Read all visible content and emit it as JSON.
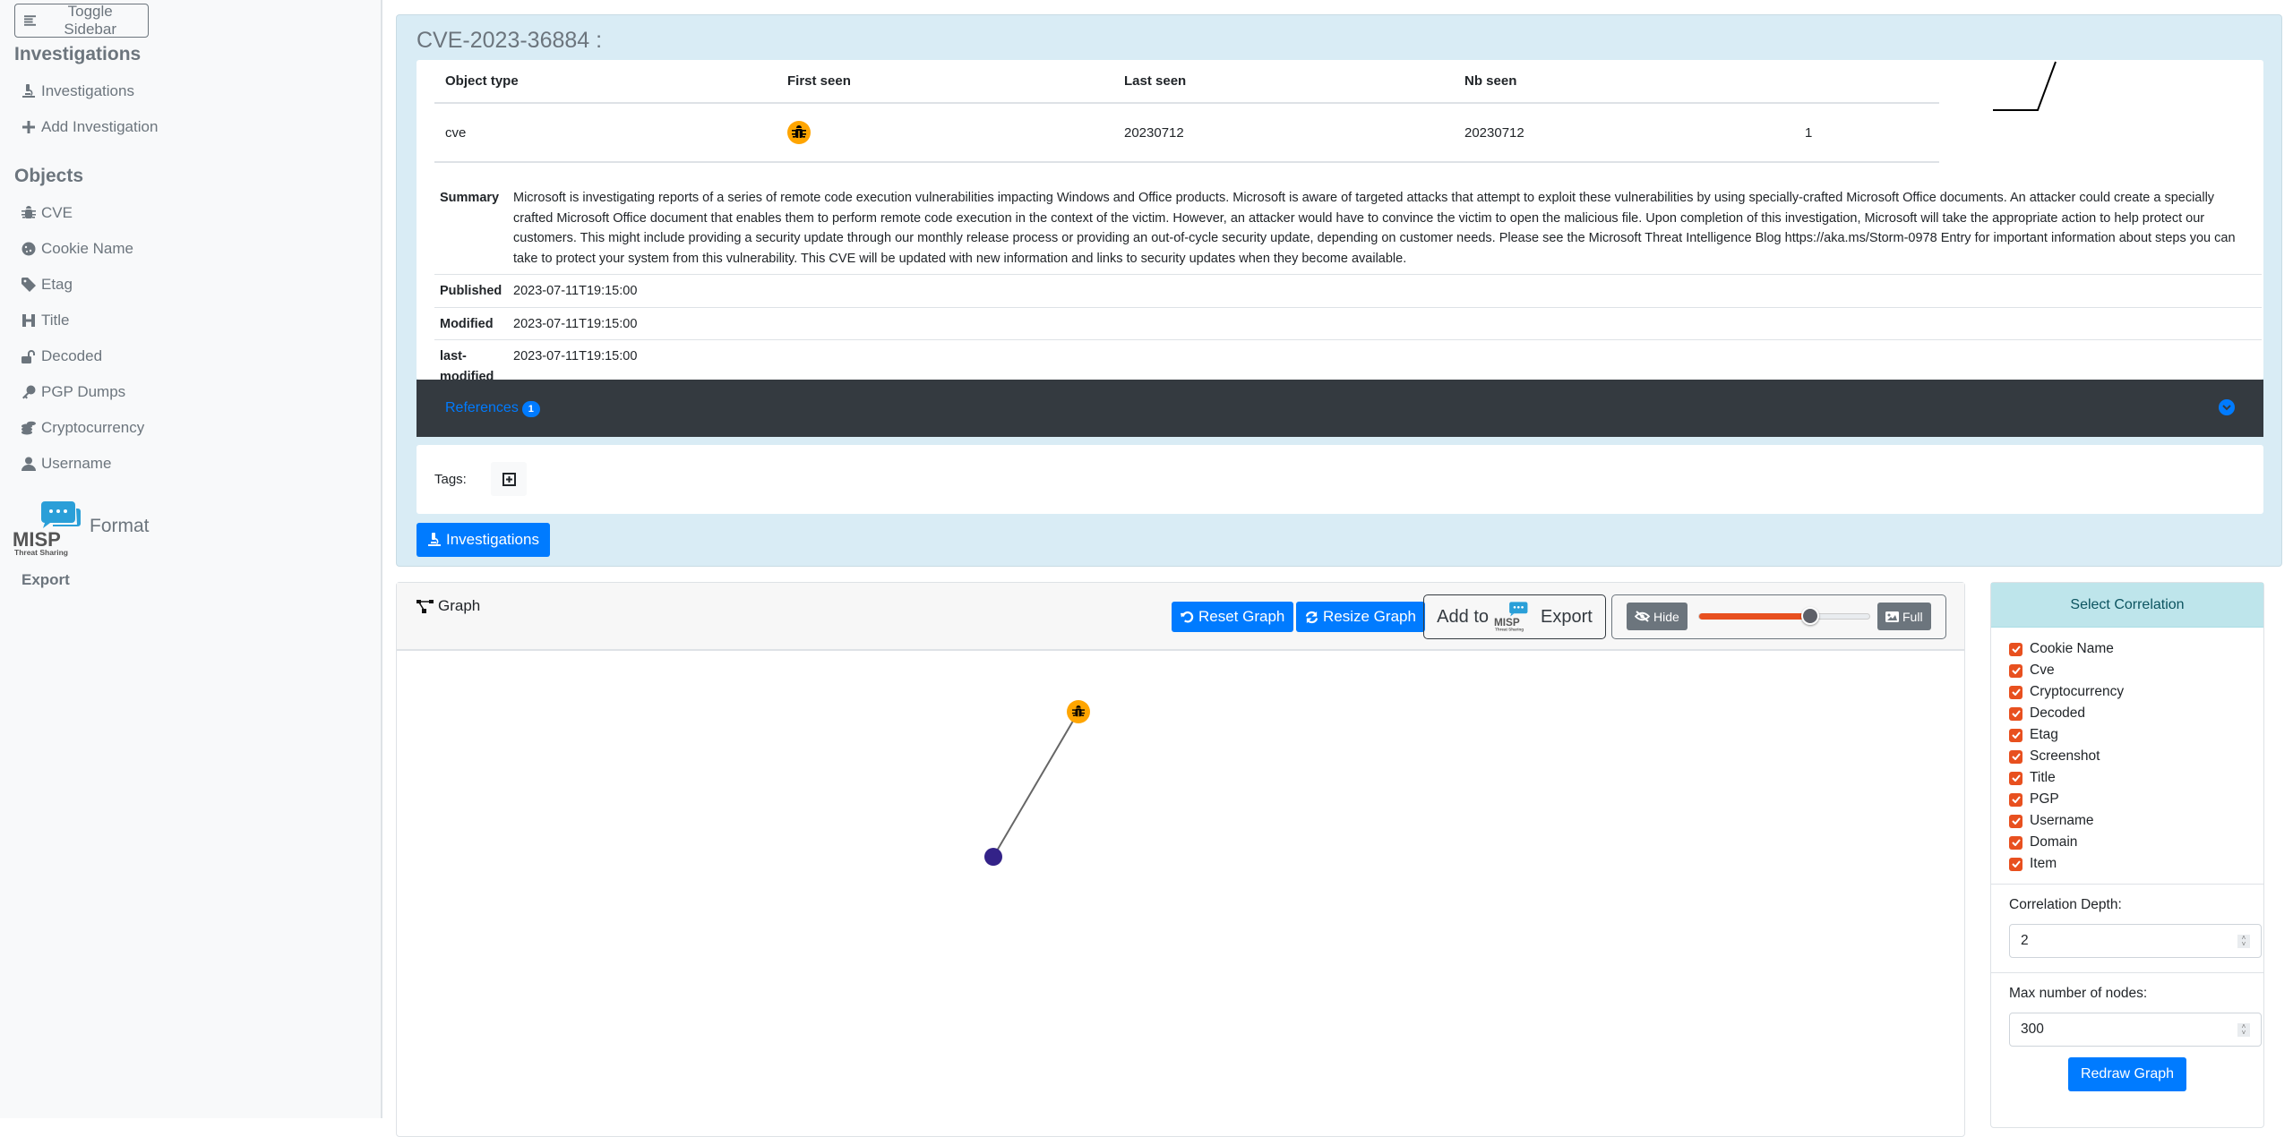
{
  "sidebar": {
    "toggle_label": "Toggle Sidebar",
    "investigations_heading": "Investigations",
    "investigation_items": [
      {
        "label": "Investigations",
        "icon": "microscope-icon"
      },
      {
        "label": "Add Investigation",
        "icon": "plus-icon"
      }
    ],
    "objects_heading": "Objects",
    "object_items": [
      {
        "label": "CVE",
        "icon": "bug-icon"
      },
      {
        "label": "Cookie Name",
        "icon": "cookie-icon"
      },
      {
        "label": "Etag",
        "icon": "tag-icon"
      },
      {
        "label": "Title",
        "icon": "heading-icon"
      },
      {
        "label": "Decoded",
        "icon": "unlock-icon"
      },
      {
        "label": "PGP Dumps",
        "icon": "key-icon"
      },
      {
        "label": "Cryptocurrency",
        "icon": "coins-icon"
      },
      {
        "label": "Username",
        "icon": "user-icon"
      }
    ],
    "logo_text": "MISP",
    "logo_subtext": "Threat Sharing",
    "format_label": "Format",
    "export_label": "Export"
  },
  "cve": {
    "title": "CVE-2023-36884 :",
    "table_headers": [
      "Object type",
      "First seen",
      "Last seen",
      "Nb seen"
    ],
    "row": {
      "object_type": "cve",
      "icon": "bug-icon",
      "first_seen": "20230712",
      "last_seen": "20230712",
      "nb_seen": "1"
    },
    "sparkline": {
      "type": "line",
      "values": [
        0,
        0,
        0,
        1
      ]
    },
    "details": [
      {
        "key": "Summary",
        "value": "Microsoft is investigating reports of a series of remote code execution vulnerabilities impacting Windows and Office products. Microsoft is aware of targeted attacks that attempt to exploit these vulnerabilities by using specially-crafted Microsoft Office documents. An attacker could create a specially crafted Microsoft Office document that enables them to perform remote code execution in the context of the victim. However, an attacker would have to convince the victim to open the malicious file. Upon completion of this investigation, Microsoft will take the appropriate action to help protect our customers. This might include providing a security update through our monthly release process or providing an out-of-cycle security update, depending on customer needs. Please see the Microsoft Threat Intelligence Blog https://aka.ms/Storm-0978  Entry for important information about steps you can take to protect your system from this vulnerability. This CVE will be updated with new information and links to security updates when they become available."
      },
      {
        "key": "Published",
        "value": "2023-07-11T19:15:00"
      },
      {
        "key": "Modified",
        "value": "2023-07-11T19:15:00"
      },
      {
        "key": "last-modified",
        "value": "2023-07-11T19:15:00"
      }
    ],
    "references_label": "References",
    "references_count": "1",
    "tags_label": "Tags:",
    "investigations_button": "Investigations"
  },
  "graph": {
    "title": "Graph",
    "reset_label": "Reset Graph",
    "resize_label": "Resize Graph",
    "add_to_label": "Add to",
    "misp_label": "MISP",
    "misp_sub": "Threat Sharing",
    "export_label": "Export",
    "hide_label": "Hide",
    "full_label": "Full",
    "slider_value": 0.65,
    "slider_fill_color": "#e8501f",
    "nodes": [
      {
        "id": "cve",
        "type": "cve",
        "color": "#ffa500",
        "icon": "bug-icon"
      },
      {
        "id": "related",
        "type": "item",
        "color": "#332288"
      }
    ],
    "edges": [
      {
        "source": "cve",
        "target": "related"
      }
    ]
  },
  "correlation": {
    "title": "Select Correlation",
    "options": [
      {
        "label": "Cookie Name",
        "checked": true
      },
      {
        "label": "Cve",
        "checked": true
      },
      {
        "label": "Cryptocurrency",
        "checked": true
      },
      {
        "label": "Decoded",
        "checked": true
      },
      {
        "label": "Etag",
        "checked": true
      },
      {
        "label": "Screenshot",
        "checked": true
      },
      {
        "label": "Title",
        "checked": true
      },
      {
        "label": "PGP",
        "checked": true
      },
      {
        "label": "Username",
        "checked": true
      },
      {
        "label": "Domain",
        "checked": true
      },
      {
        "label": "Item",
        "checked": true
      }
    ],
    "depth_label": "Correlation Depth:",
    "depth_value": "2",
    "max_nodes_label": "Max number of nodes:",
    "max_nodes_value": "300",
    "redraw_label": "Redraw Graph"
  }
}
